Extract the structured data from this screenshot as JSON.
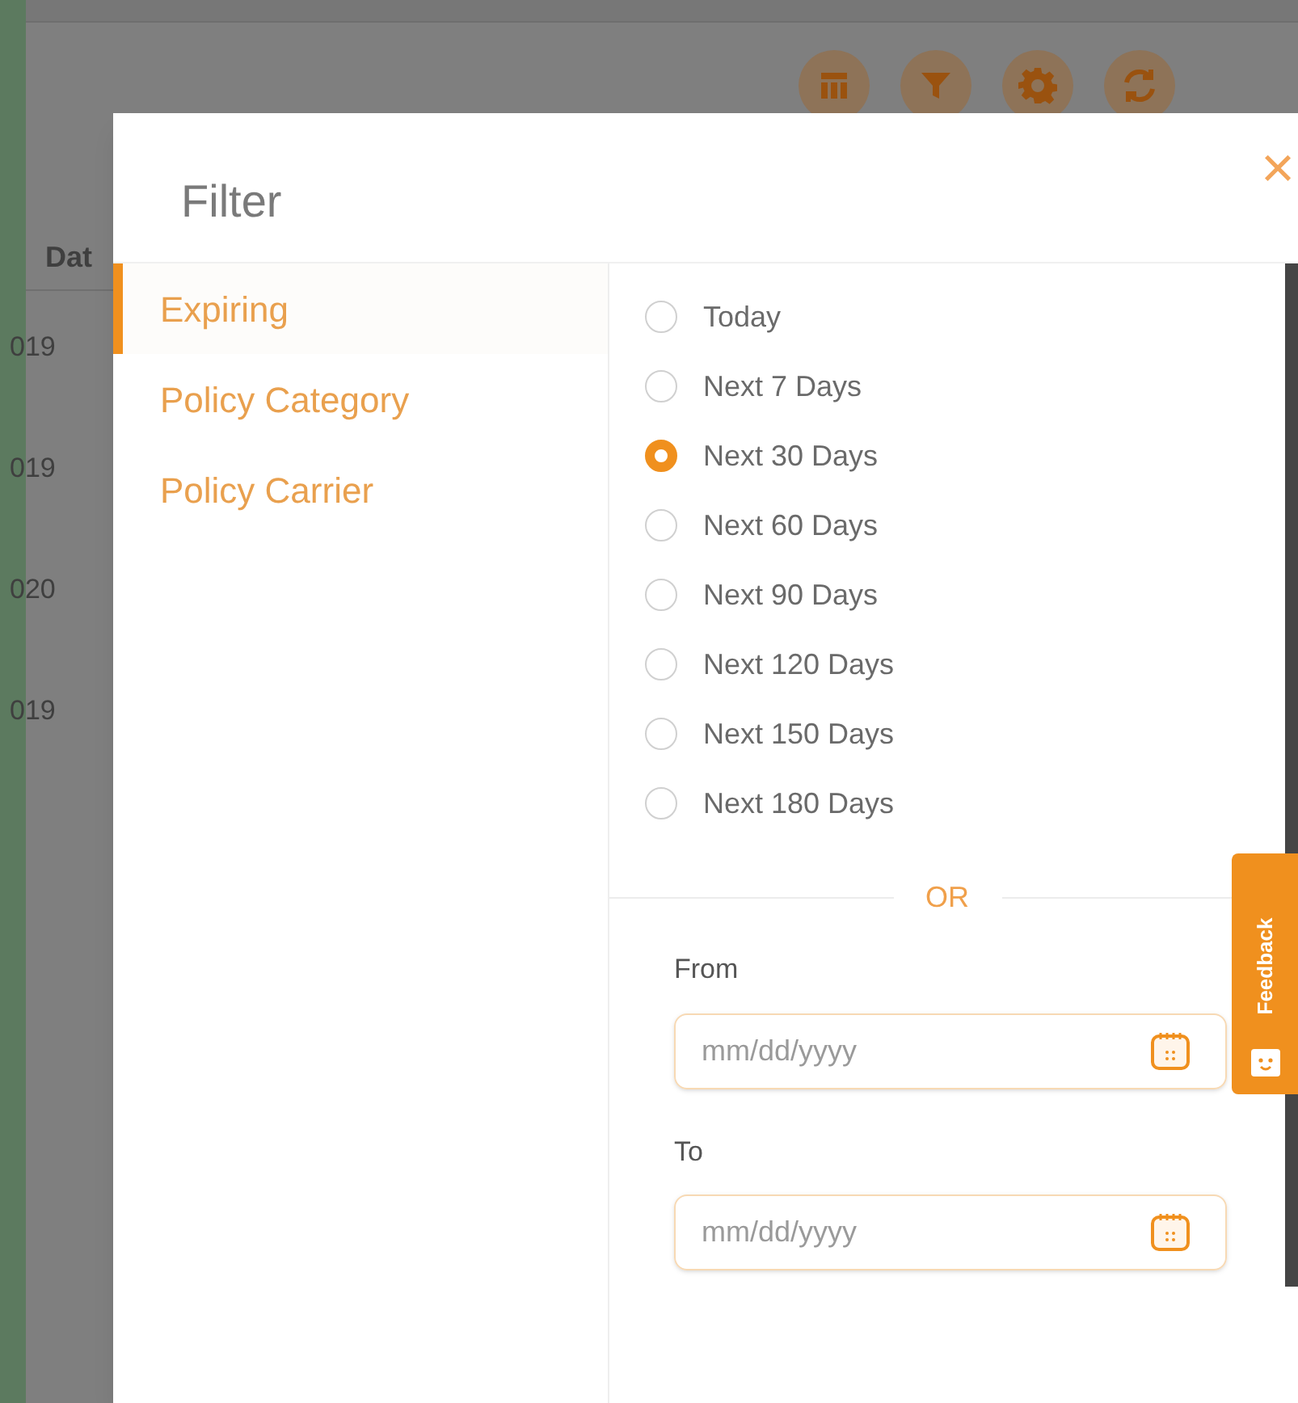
{
  "background_table": {
    "column_header": "Dat",
    "cells": [
      "019",
      "019",
      "020",
      "019"
    ]
  },
  "filter_dialog": {
    "title": "Filter",
    "close": "×",
    "categories": [
      {
        "label": "Expiring",
        "selected": true
      },
      {
        "label": "Policy Category",
        "selected": false
      },
      {
        "label": "Policy Carrier",
        "selected": false
      }
    ],
    "options": [
      {
        "label": "Today",
        "selected": false
      },
      {
        "label": "Next 7 Days",
        "selected": false
      },
      {
        "label": "Next 30 Days",
        "selected": true
      },
      {
        "label": "Next 60 Days",
        "selected": false
      },
      {
        "label": "Next 90 Days",
        "selected": false
      },
      {
        "label": "Next 120 Days",
        "selected": false
      },
      {
        "label": "Next 150 Days",
        "selected": false
      },
      {
        "label": "Next 180 Days",
        "selected": false
      }
    ],
    "separator": "OR",
    "from": {
      "label": "From",
      "placeholder": "mm/dd/yyyy"
    },
    "to": {
      "label": "To",
      "placeholder": "mm/dd/yyyy"
    }
  },
  "feedback_tab": {
    "label": "Feedback"
  }
}
